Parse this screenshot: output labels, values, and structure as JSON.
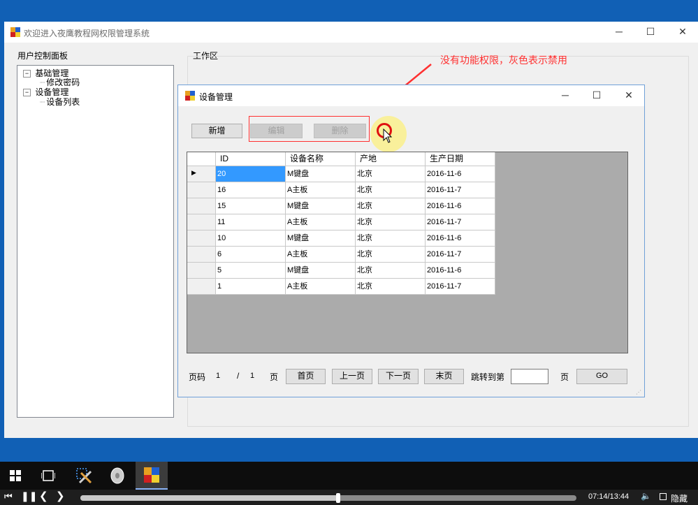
{
  "main_window": {
    "title": "欢迎进入夜鹰教程网权限管理系统",
    "left_panel_label": "用户控制面板",
    "tree": [
      {
        "label": "基础管理",
        "children": [
          "修改密码"
        ]
      },
      {
        "label": "设备管理",
        "children": [
          "设备列表"
        ]
      }
    ],
    "work_area_label": "工作区"
  },
  "annotation": {
    "text": "没有功能权限，灰色表示禁用",
    "color": "#ff3030"
  },
  "child_window": {
    "title": "设备管理",
    "toolbar": {
      "add": "新增",
      "edit": "编辑",
      "delete": "删除"
    },
    "grid": {
      "columns": [
        "ID",
        "设备名称",
        "产地",
        "生产日期"
      ],
      "rows": [
        {
          "id": "20",
          "name": "M键盘",
          "origin": "北京",
          "date": "2016-11-6"
        },
        {
          "id": "16",
          "name": "A主板",
          "origin": "北京",
          "date": "2016-11-7"
        },
        {
          "id": "15",
          "name": "M键盘",
          "origin": "北京",
          "date": "2016-11-6"
        },
        {
          "id": "11",
          "name": "A主板",
          "origin": "北京",
          "date": "2016-11-7"
        },
        {
          "id": "10",
          "name": "M键盘",
          "origin": "北京",
          "date": "2016-11-6"
        },
        {
          "id": "6",
          "name": "A主板",
          "origin": "北京",
          "date": "2016-11-7"
        },
        {
          "id": "5",
          "name": "M键盘",
          "origin": "北京",
          "date": "2016-11-6"
        },
        {
          "id": "1",
          "name": "A主板",
          "origin": "北京",
          "date": "2016-11-7"
        }
      ]
    },
    "pager": {
      "page_label": "页码",
      "current": "1",
      "separator": "/",
      "total": "1",
      "page_unit": "页",
      "first": "首页",
      "prev": "上一页",
      "next": "下一页",
      "last": "末页",
      "jump_label": "跳转到第",
      "jump_value": "",
      "jump_unit": "页",
      "go": "GO"
    }
  },
  "player": {
    "time": "07:14/13:44",
    "hide": "隐藏",
    "progress": 0.52
  },
  "colors": {
    "desktop": "#1160b5",
    "selection": "#3399ff",
    "grid_bg": "#ababab"
  }
}
